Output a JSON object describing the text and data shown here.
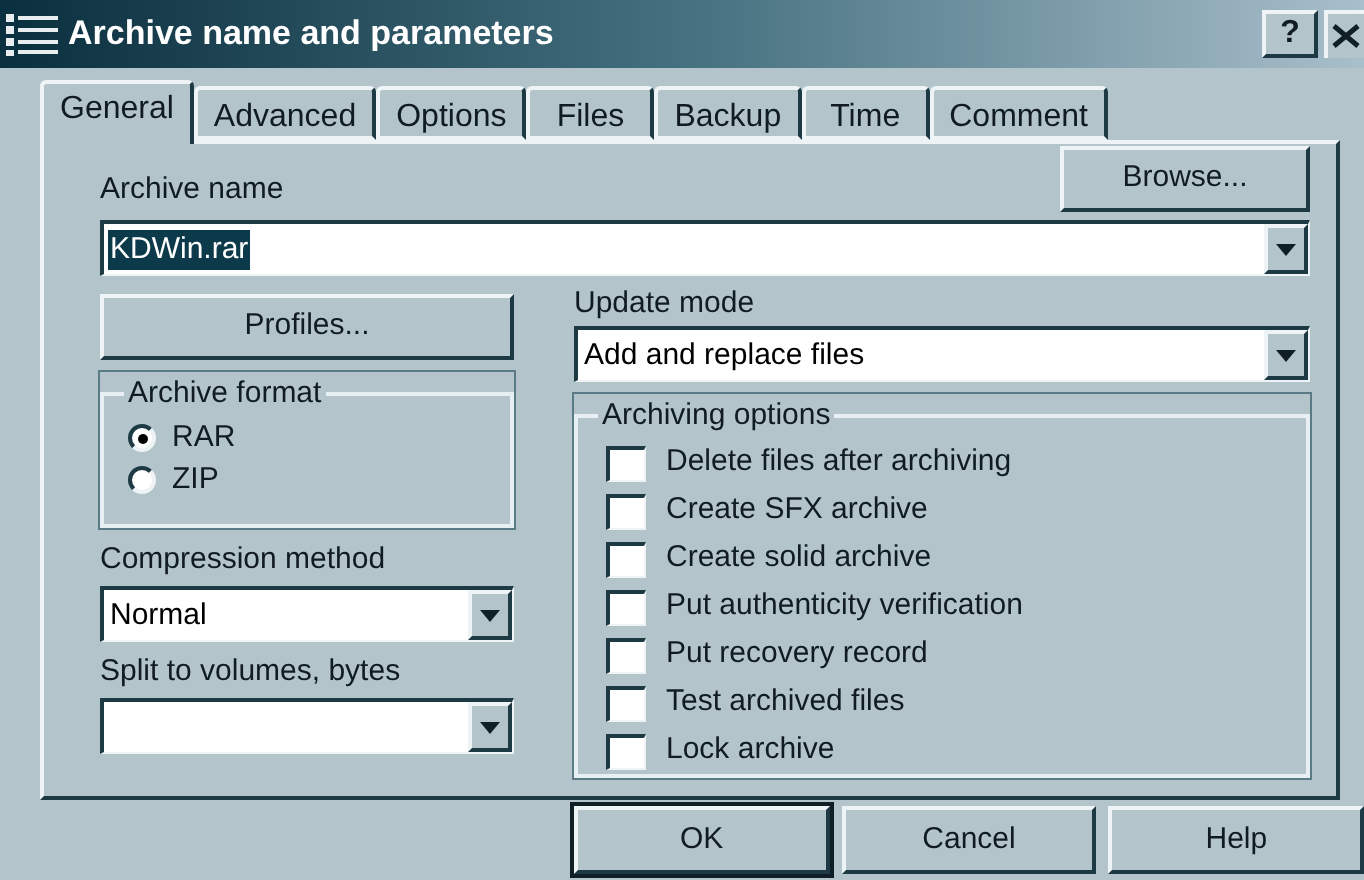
{
  "window": {
    "title": "Archive name and parameters",
    "help_button": "?"
  },
  "tabs": [
    {
      "label": "General",
      "selected": true
    },
    {
      "label": "Advanced",
      "selected": false
    },
    {
      "label": "Options",
      "selected": false
    },
    {
      "label": "Files",
      "selected": false
    },
    {
      "label": "Backup",
      "selected": false
    },
    {
      "label": "Time",
      "selected": false
    },
    {
      "label": "Comment",
      "selected": false
    }
  ],
  "archive_name": {
    "label": "Archive name",
    "value": "KDWin.rar",
    "value_highlighted": true,
    "browse_button": "Browse..."
  },
  "profiles_button": "Profiles...",
  "archive_format": {
    "title": "Archive format",
    "options": [
      {
        "label": "RAR",
        "selected": true
      },
      {
        "label": "ZIP",
        "selected": false
      }
    ]
  },
  "compression_method": {
    "label": "Compression method",
    "value": "Normal"
  },
  "split_to_volumes": {
    "label": "Split to volumes, bytes"
  },
  "update_mode": {
    "label": "Update mode",
    "value": "Add and replace files"
  },
  "archiving_options": {
    "title": "Archiving options",
    "items": [
      {
        "label": "Delete files after archiving",
        "checked": false
      },
      {
        "label": "Create SFX archive",
        "checked": false
      },
      {
        "label": "Create solid archive",
        "checked": false
      },
      {
        "label": "Put authenticity verification",
        "checked": false
      },
      {
        "label": "Put recovery record",
        "checked": false
      },
      {
        "label": "Test archived files",
        "checked": false
      },
      {
        "label": "Lock archive",
        "checked": false
      }
    ]
  },
  "buttons": [
    {
      "label": "OK",
      "default": true
    },
    {
      "label": "Cancel",
      "default": false
    },
    {
      "label": "Help",
      "default": false
    }
  ]
}
